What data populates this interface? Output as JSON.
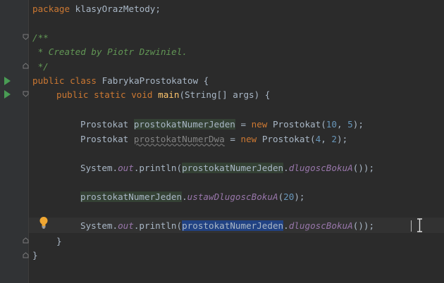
{
  "editor": {
    "package_kw": "package",
    "package_name": " klasyOrazMetody;",
    "doc_open": "/**",
    "doc_body": " * Created by Piotr Dzwiniel.",
    "doc_close": " */",
    "class_kw_public": "public",
    "class_kw_class": "class",
    "class_name": " FabrykaProstokatow {",
    "main_kw_public": "public",
    "main_kw_static": "static",
    "main_kw_void": "void",
    "main_name": "main",
    "main_params": "(String[] args) {",
    "decl1_type": "Prostokat ",
    "decl1_var": "prostokatNumerJeden",
    "decl1_eq": " = ",
    "decl1_new": "new",
    "decl1_ctor": " Prostokat(",
    "decl1_arg1": "10",
    "decl1_sep": ", ",
    "decl1_arg2": "5",
    "decl1_end": ");",
    "decl2_type": "Prostokat ",
    "decl2_var": "prostokatNumerDwa",
    "decl2_eq": " = ",
    "decl2_new": "new",
    "decl2_ctor": " Prostokat(",
    "decl2_arg1": "4",
    "decl2_sep": ", ",
    "decl2_arg2": "2",
    "decl2_end": ");",
    "print1_sys": "System.",
    "print1_out": "out",
    "print1_println": ".println(",
    "print1_var": "prostokatNumerJeden",
    "print1_dot": ".",
    "print1_method": "dlugoscBokuA",
    "print1_end": "());",
    "set_var": "prostokatNumerJeden",
    "set_dot": ".",
    "set_method": "ustawDlugoscBokuA",
    "set_open": "(",
    "set_arg": "20",
    "set_end": ");",
    "print2_sys": "System.",
    "print2_out": "out",
    "print2_println": ".println(",
    "print2_var": "prostokatNumerJeden",
    "print2_dot": ".",
    "print2_method": "dlugoscBokuA",
    "print2_end": "());",
    "close_main": "}",
    "close_class": "}"
  },
  "colors": {
    "background": "#2b2b2b",
    "gutter": "#313335",
    "keyword": "#cc7832",
    "comment": "#629755",
    "number": "#6897bb",
    "field": "#9876aa",
    "method": "#ffc66d",
    "selection": "#214283",
    "run_icon": "#499c54",
    "bulb": "#f0a732"
  },
  "icons": {
    "run": "run-gutter-icon",
    "fold": "fold-marker-icon",
    "intention": "lightbulb-icon",
    "cursor": "text-cursor-icon"
  }
}
